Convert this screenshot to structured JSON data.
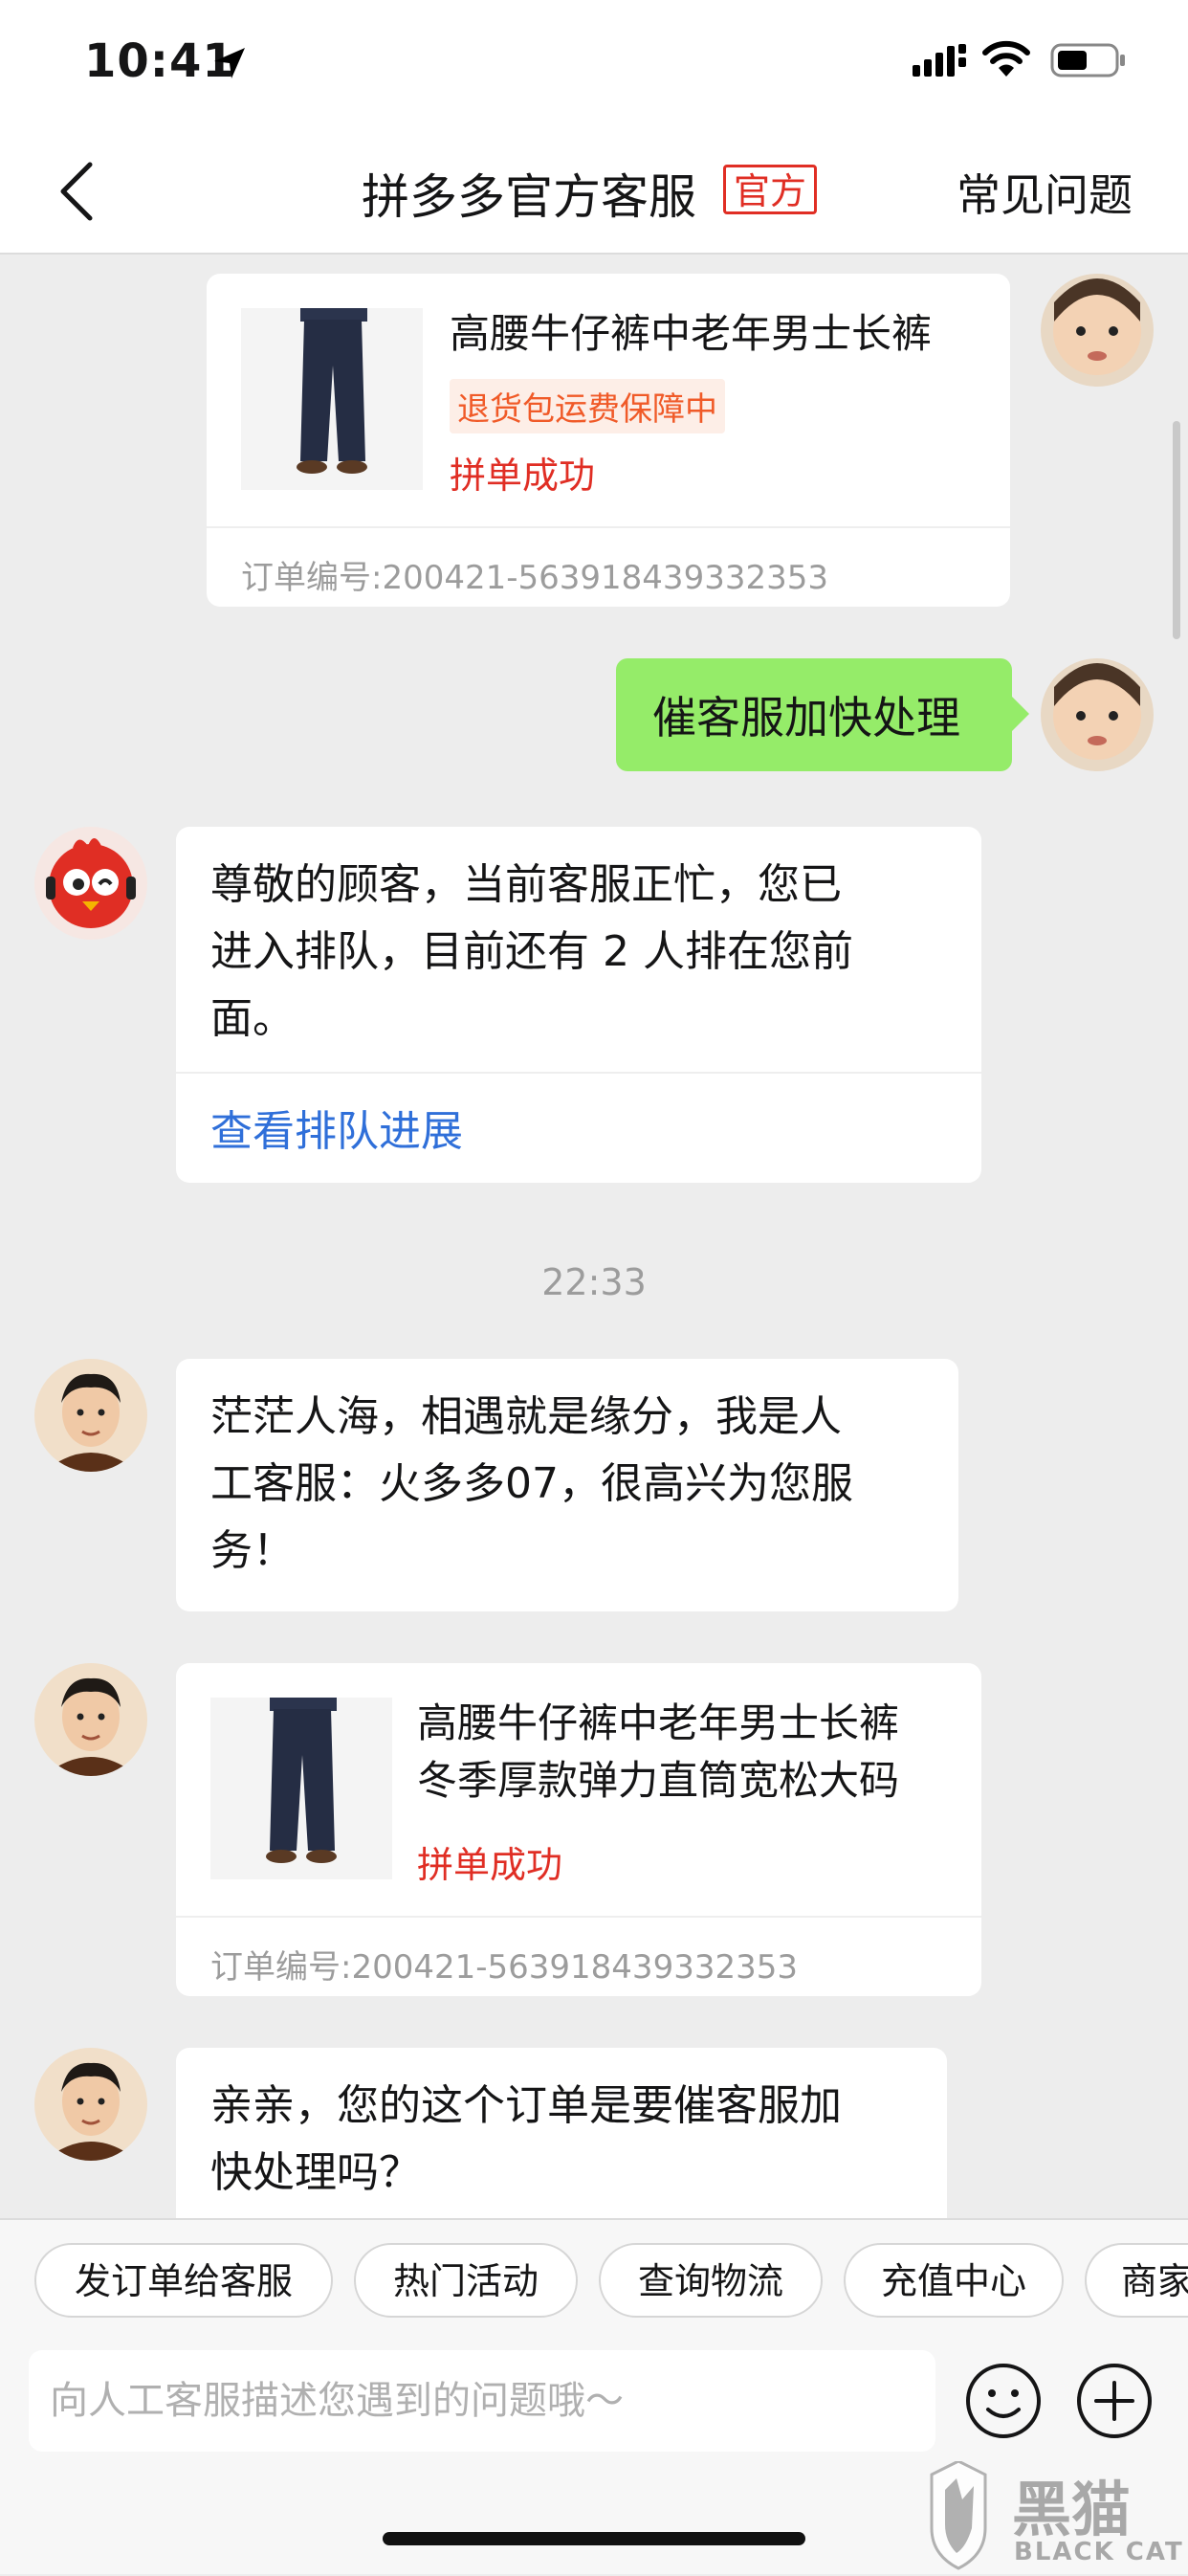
{
  "status_bar": {
    "time": "10:41"
  },
  "header": {
    "title": "拼多多官方客服",
    "official_badge": "官方",
    "faq": "常见问题"
  },
  "messages": {
    "product_card_1": {
      "title": "高腰牛仔裤中老年男士长裤",
      "tag": "退货包运费保障中",
      "status": "拼单成功",
      "order_no": "订单编号:200421-563918439332353"
    },
    "user_msg": "催客服加快处理",
    "queue_msg": {
      "line1": "尊敬的顾客，当前客服正忙，您已",
      "line2": "进入排队，目前还有 2 人排在您前",
      "line3": "面。",
      "link": "查看排队进展"
    },
    "timestamp": "22:33",
    "agent_greeting": {
      "line1": "茫茫人海，相遇就是缘分，我是人",
      "line2": "工客服：火多多07，很高兴为您服",
      "line3": "务！"
    },
    "product_card_2": {
      "title_line1": "高腰牛仔裤中老年男士长裤",
      "title_line2": "冬季厚款弹力直筒宽松大码",
      "status": "拼单成功",
      "order_no": "订单编号:200421-563918439332353"
    },
    "agent_question": {
      "line1": "亲亲，您的这个订单是要催客服加",
      "line2": "快处理吗？"
    }
  },
  "quick_actions": [
    "发订单给客服",
    "热门活动",
    "查询物流",
    "充值中心",
    "商家"
  ],
  "input": {
    "placeholder": "向人工客服描述您遇到的问题哦～"
  },
  "watermark": {
    "brand": "黑猫",
    "sub": "BLACK CAT"
  },
  "colors": {
    "accent_red": "#e02e24",
    "tag_orange": "#f05a28",
    "link_blue": "#2f6fd9",
    "bubble_green": "#95ec69",
    "background": "#ededed"
  },
  "icons": [
    "location-arrow-icon",
    "signal-icon",
    "wifi-icon",
    "battery-icon",
    "back-chevron-icon",
    "emoji-icon",
    "plus-icon"
  ]
}
